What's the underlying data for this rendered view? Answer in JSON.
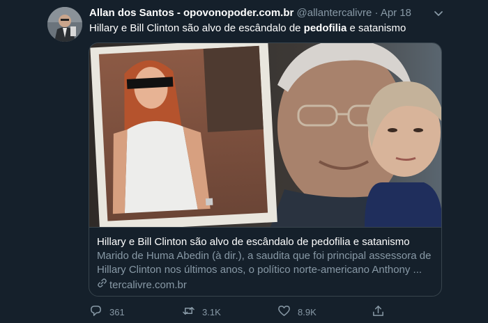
{
  "tweet": {
    "author_name": "Allan dos Santos - opovonopoder.com.br",
    "handle": "@allantercalivre",
    "separator": "·",
    "date": "Apr 18",
    "text_before": "Hillary e Bill Clinton são alvo de escândalo de ",
    "text_bold": "pedofilia",
    "text_after": " e satanismo"
  },
  "card": {
    "title": "Hillary e Bill Clinton são alvo de escândalo de pedofilia e satanismo",
    "description_line1": "Marido de Huma Abedin (à dir.), a saudita que foi principal assessora de",
    "description_line2": "Hillary Clinton nos últimos anos, o político norte-americano Anthony ...",
    "domain": "tercalivre.com.br"
  },
  "actions": {
    "replies": "361",
    "retweets": "3.1K",
    "likes": "8.9K"
  },
  "icons": {
    "caret": "chevron-down-icon",
    "link": "link-icon",
    "reply": "reply-icon",
    "retweet": "retweet-icon",
    "like": "heart-icon",
    "share": "share-icon"
  },
  "colors": {
    "background": "#15202b",
    "text": "#ffffff",
    "secondary": "#8899a6",
    "border": "#38444d"
  }
}
